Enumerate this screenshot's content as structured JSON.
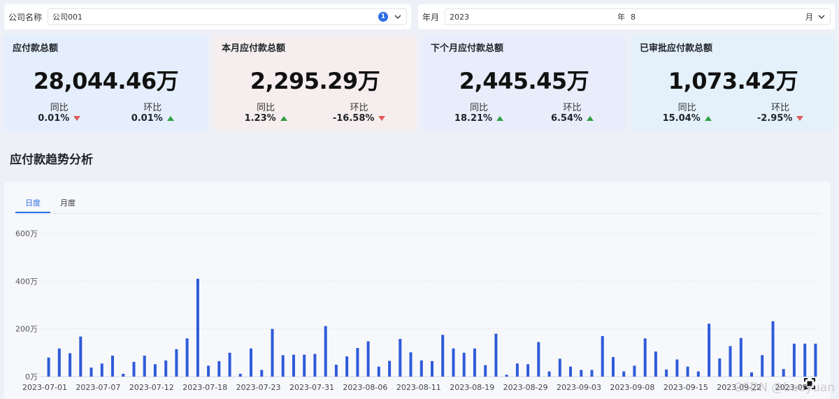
{
  "filters": {
    "company_label": "公司名称",
    "company_value": "公司001",
    "company_count": "1",
    "period_label": "年月",
    "year_value": "2023",
    "year_unit": "年",
    "month_value": "8",
    "month_unit": "月"
  },
  "kpis": [
    {
      "title": "应付款总额",
      "value": "28,044.46万",
      "yoy_label": "同比",
      "yoy": "0.01%",
      "yoy_dir": "down",
      "mom_label": "环比",
      "mom": "0.01%",
      "mom_dir": "up"
    },
    {
      "title": "本月应付款总额",
      "value": "2,295.29万",
      "yoy_label": "同比",
      "yoy": "1.23%",
      "yoy_dir": "up",
      "mom_label": "环比",
      "mom": "-16.58%",
      "mom_dir": "down"
    },
    {
      "title": "下个月应付款总额",
      "value": "2,445.45万",
      "yoy_label": "同比",
      "yoy": "18.21%",
      "yoy_dir": "up",
      "mom_label": "环比",
      "mom": "6.54%",
      "mom_dir": "up"
    },
    {
      "title": "已审批应付款总额",
      "value": "1,073.42万",
      "yoy_label": "同比",
      "yoy": "15.04%",
      "yoy_dir": "up",
      "mom_label": "环比",
      "mom": "-2.95%",
      "mom_dir": "down"
    }
  ],
  "section_title": "应付款趋势分析",
  "tabs": [
    {
      "label": "日度",
      "active": true
    },
    {
      "label": "月度",
      "active": false
    }
  ],
  "colors": {
    "accent": "#2f6ee6",
    "bar": "#2f5bd8",
    "up": "#2ea043",
    "down": "#e05a5a"
  },
  "icons": {
    "select_toggle": "chevron-down-icon",
    "fullscreen": "screenshot-icon",
    "trend_up": "arrow-up-icon",
    "trend_down": "arrow-down-icon"
  },
  "watermark": "CSDN @baoyuan",
  "chart_data": {
    "type": "bar",
    "title": "",
    "xlabel": "",
    "ylabel": "",
    "ylim": [
      0,
      600
    ],
    "y_ticks": [
      "0万",
      "200万",
      "400万",
      "600万"
    ],
    "y_tick_values": [
      0,
      200,
      400,
      600
    ],
    "grid": true,
    "x_tick_labels": [
      "2023-07-01",
      "2023-07-07",
      "2023-07-12",
      "2023-07-18",
      "2023-07-23",
      "2023-07-31",
      "2023-08-06",
      "2023-08-11",
      "2023-08-19",
      "2023-08-29",
      "2023-09-03",
      "2023-09-08",
      "2023-09-15",
      "2023-09-22",
      "2023-09-"
    ],
    "values": [
      80,
      118,
      98,
      168,
      38,
      55,
      88,
      12,
      62,
      88,
      52,
      68,
      115,
      160,
      410,
      46,
      65,
      100,
      12,
      118,
      28,
      200,
      90,
      92,
      92,
      95,
      212,
      50,
      85,
      120,
      148,
      42,
      66,
      158,
      102,
      68,
      65,
      175,
      118,
      100,
      118,
      48,
      180,
      8,
      55,
      52,
      145,
      22,
      75,
      42,
      28,
      28,
      170,
      82,
      22,
      46,
      160,
      105,
      30,
      72,
      42,
      22,
      222,
      76,
      128,
      162,
      18,
      90,
      232,
      32,
      138,
      138,
      138
    ]
  }
}
